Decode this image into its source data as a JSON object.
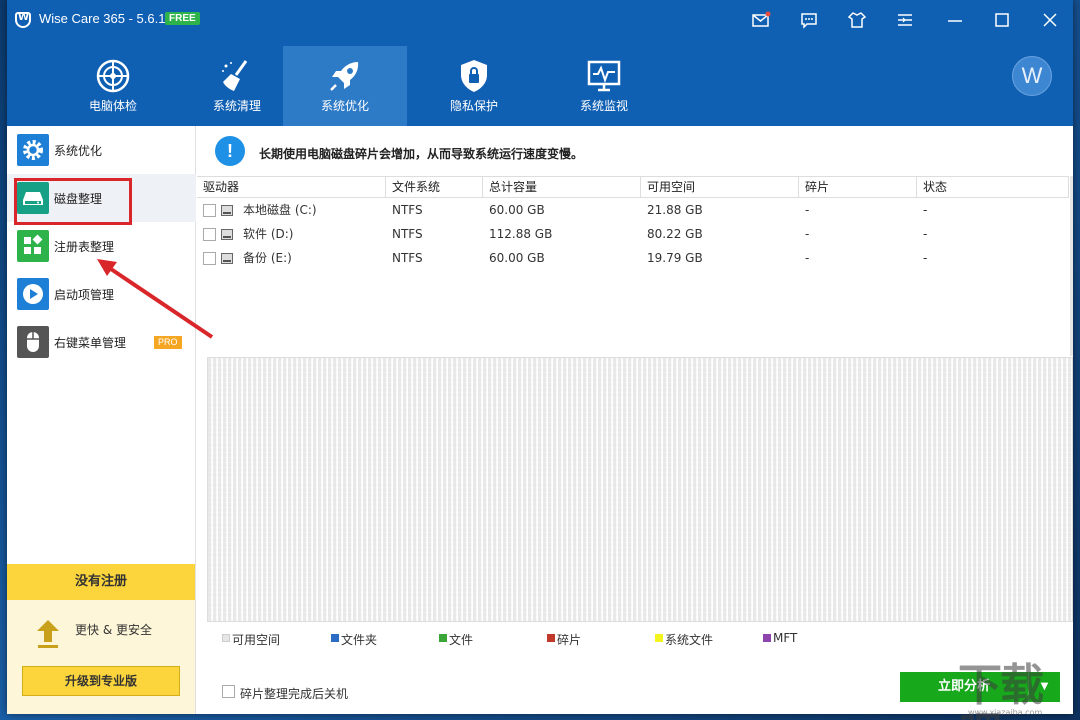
{
  "app": {
    "title": "Wise Care 365 - 5.6.1",
    "badge": "FREE"
  },
  "titlebar_buttons": [
    {
      "name": "mail-icon"
    },
    {
      "name": "feedback-icon"
    },
    {
      "name": "skin-icon"
    },
    {
      "name": "menu-icon"
    },
    {
      "name": "minimize-icon"
    },
    {
      "name": "maximize-icon"
    },
    {
      "name": "close-icon"
    }
  ],
  "nav": [
    {
      "label": "电脑体检",
      "icon": "radar-icon",
      "active": false
    },
    {
      "label": "系统清理",
      "icon": "broom-icon",
      "active": false
    },
    {
      "label": "系统优化",
      "icon": "rocket-icon",
      "active": true
    },
    {
      "label": "隐私保护",
      "icon": "shield-lock-icon",
      "active": false
    },
    {
      "label": "系统监视",
      "icon": "monitor-pulse-icon",
      "active": false
    }
  ],
  "user": {
    "avatar_letter": "W"
  },
  "sidebar": {
    "items": [
      {
        "label": "系统优化",
        "icon": "gear-icon",
        "color": "#1e7fd6"
      },
      {
        "label": "磁盘整理",
        "icon": "disk-icon",
        "color": "#16a085"
      },
      {
        "label": "注册表整理",
        "icon": "registry-icon",
        "color": "#2db34a"
      },
      {
        "label": "启动项管理",
        "icon": "startup-play-icon",
        "color": "#1e7fd6"
      },
      {
        "label": "右键菜单管理",
        "icon": "mouse-icon",
        "color": "#555555",
        "badge": "PRO"
      }
    ],
    "active_index": 1,
    "register": {
      "title": "没有注册",
      "benefit": "更快 & 更安全",
      "upgrade_label": "升级到专业版"
    }
  },
  "notice": {
    "icon": "info-icon",
    "text": "长期使用电脑磁盘碎片会增加，从而导致系统运行速度变慢。"
  },
  "table": {
    "headers": [
      "驱动器",
      "文件系统",
      "总计容量",
      "可用空间",
      "碎片",
      "状态"
    ],
    "rows": [
      {
        "drive": "本地磁盘 (C:)",
        "fs": "NTFS",
        "total": "60.00 GB",
        "free": "21.88 GB",
        "frag": "-",
        "status": "-"
      },
      {
        "drive": "软件 (D:)",
        "fs": "NTFS",
        "total": "112.88 GB",
        "free": "80.22 GB",
        "frag": "-",
        "status": "-"
      },
      {
        "drive": "备份 (E:)",
        "fs": "NTFS",
        "total": "60.00 GB",
        "free": "19.79 GB",
        "frag": "-",
        "status": "-"
      }
    ]
  },
  "legend": [
    {
      "label": "可用空间",
      "color": "#e6e6e6"
    },
    {
      "label": "文件夹",
      "color": "#2b6cc4"
    },
    {
      "label": "文件",
      "color": "#3aa63a"
    },
    {
      "label": "碎片",
      "color": "#c0392b"
    },
    {
      "label": "系统文件",
      "color": "#f3f31f"
    },
    {
      "label": "MFT",
      "color": "#8e44ad"
    }
  ],
  "footer": {
    "shutdown_label": "碎片整理完成后关机",
    "analyze_label": "立即分析",
    "analyze_dropdown": "▼"
  },
  "watermark": {
    "text": "下载吧",
    "url": "www.xiazaiba.com"
  }
}
